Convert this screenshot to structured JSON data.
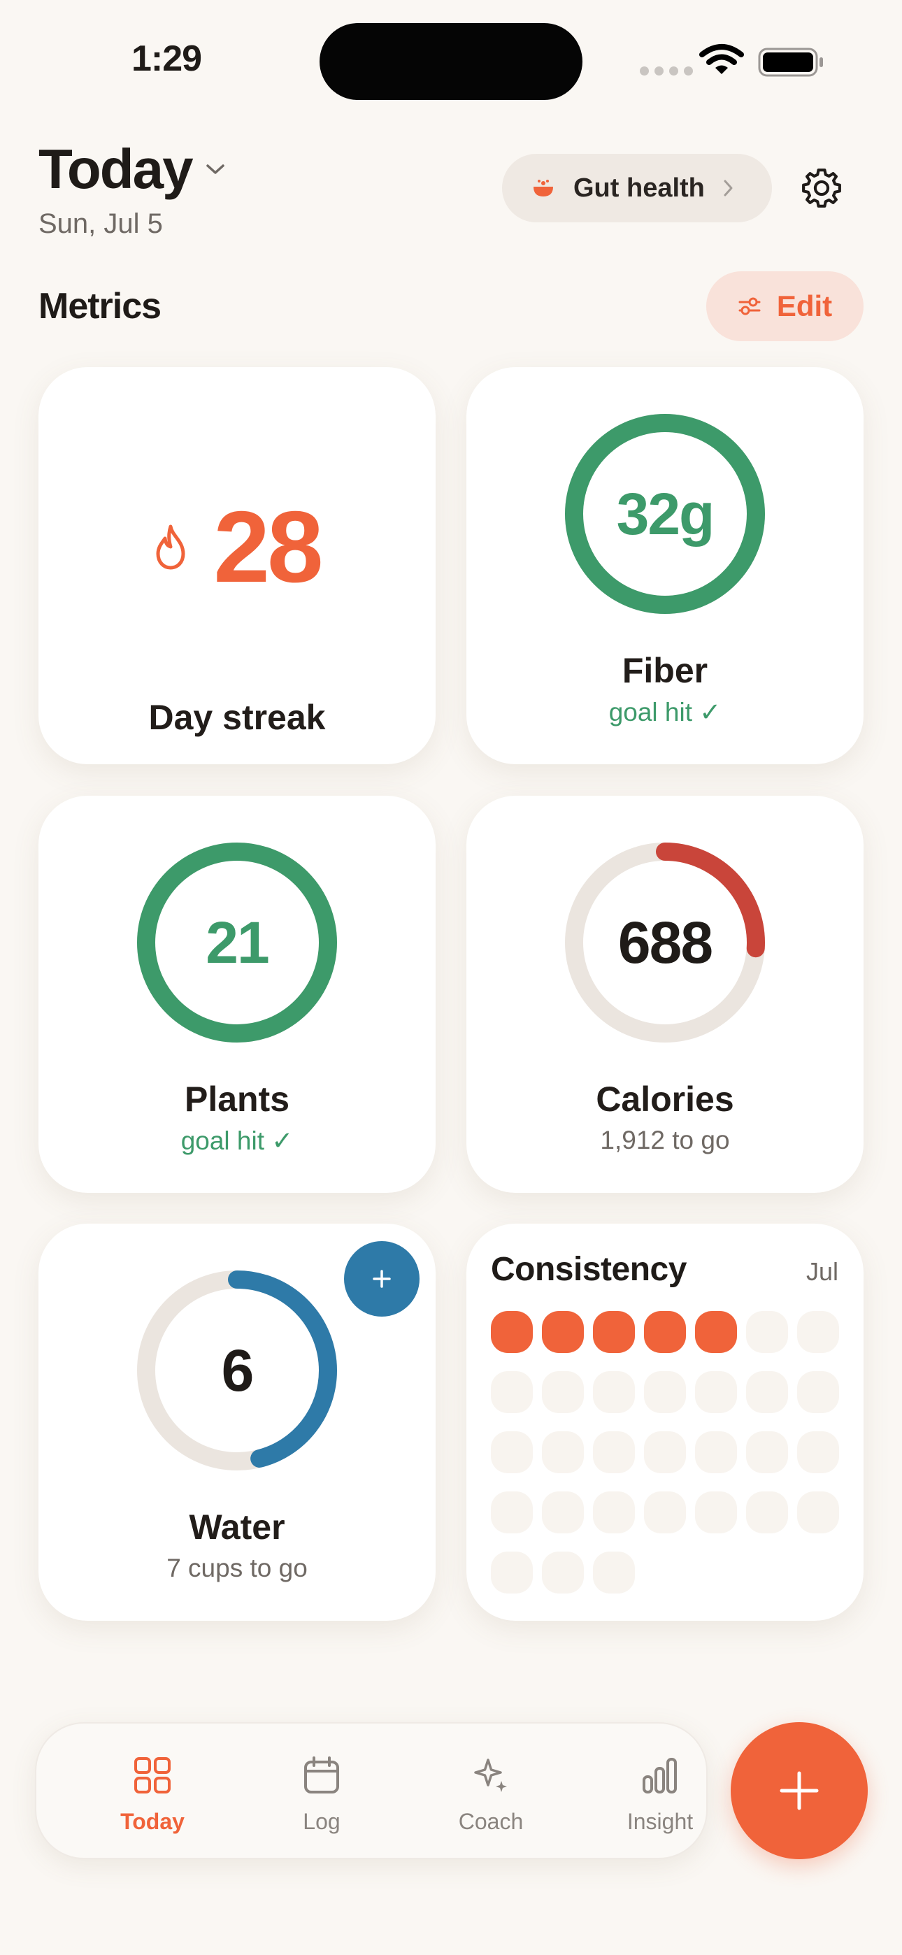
{
  "status_bar": {
    "time": "1:29"
  },
  "header": {
    "title": "Today",
    "date": "Sun, Jul 5",
    "focus_chip": "Gut health"
  },
  "metrics": {
    "section_title": "Metrics",
    "edit_label": "Edit",
    "streak": {
      "value": "28",
      "label": "Day streak"
    },
    "fiber": {
      "value": "32g",
      "label": "Fiber",
      "status": "goal hit ✓",
      "progress": 1.0
    },
    "plants": {
      "value": "21",
      "label": "Plants",
      "status": "goal hit ✓",
      "progress": 1.0
    },
    "calories": {
      "value": "688",
      "label": "Calories",
      "status": "1,912 to go",
      "progress": 0.26
    },
    "water": {
      "value": "6",
      "label": "Water",
      "status": "7 cups to go",
      "progress": 0.46
    },
    "consistency": {
      "title": "Consistency",
      "month": "Jul",
      "days": [
        true,
        true,
        true,
        true,
        true,
        false,
        false,
        false,
        false,
        false,
        false,
        false,
        false,
        false,
        false,
        false,
        false,
        false,
        false,
        false,
        false,
        false,
        false,
        false,
        false,
        false,
        false,
        false,
        false,
        false,
        false
      ]
    }
  },
  "tabs": [
    {
      "label": "Today",
      "icon": "grid-icon",
      "active": true
    },
    {
      "label": "Log",
      "icon": "calendar-icon",
      "active": false
    },
    {
      "label": "Coach",
      "icon": "sparkle-icon",
      "active": false
    },
    {
      "label": "Insight",
      "icon": "bar-chart-icon",
      "active": false
    }
  ],
  "colors": {
    "accent": "#f0633a",
    "green": "#3d9a6a",
    "red": "#c9453a",
    "blue": "#2e7aa8",
    "track": "#ebe5df"
  }
}
